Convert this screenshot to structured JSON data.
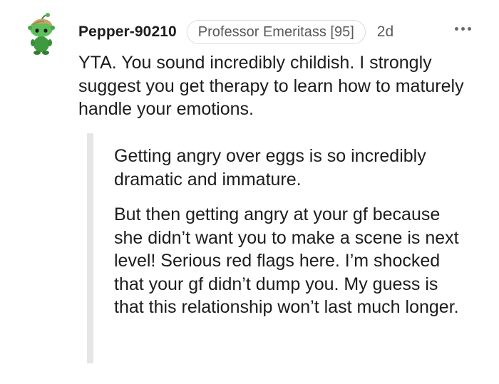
{
  "comment": {
    "avatar_icon": "snoo-avatar-icon",
    "username": "Pepper-90210",
    "flair": "Professor Emeritass [95]",
    "timestamp": "2d",
    "more_icon": "more-options-icon",
    "body": "YTA. You sound incredibly childish. I strongly suggest you get therapy to learn how to maturely handle your emotions.",
    "quote": {
      "paragraphs": [
        "Getting angry over eggs is so incredibly dramatic and immature.",
        "But then getting angry at your gf because she didn’t want you to make a scene is next level! Serious red flags here. I’m shocked that your gf didn’t dump you. My guess is that this relationship won’t last much longer."
      ]
    }
  },
  "colors": {
    "avatar_green": "#4caf50",
    "text": "#1c1c1c",
    "meta": "#595959",
    "quote_bar": "#e6e6e6"
  }
}
